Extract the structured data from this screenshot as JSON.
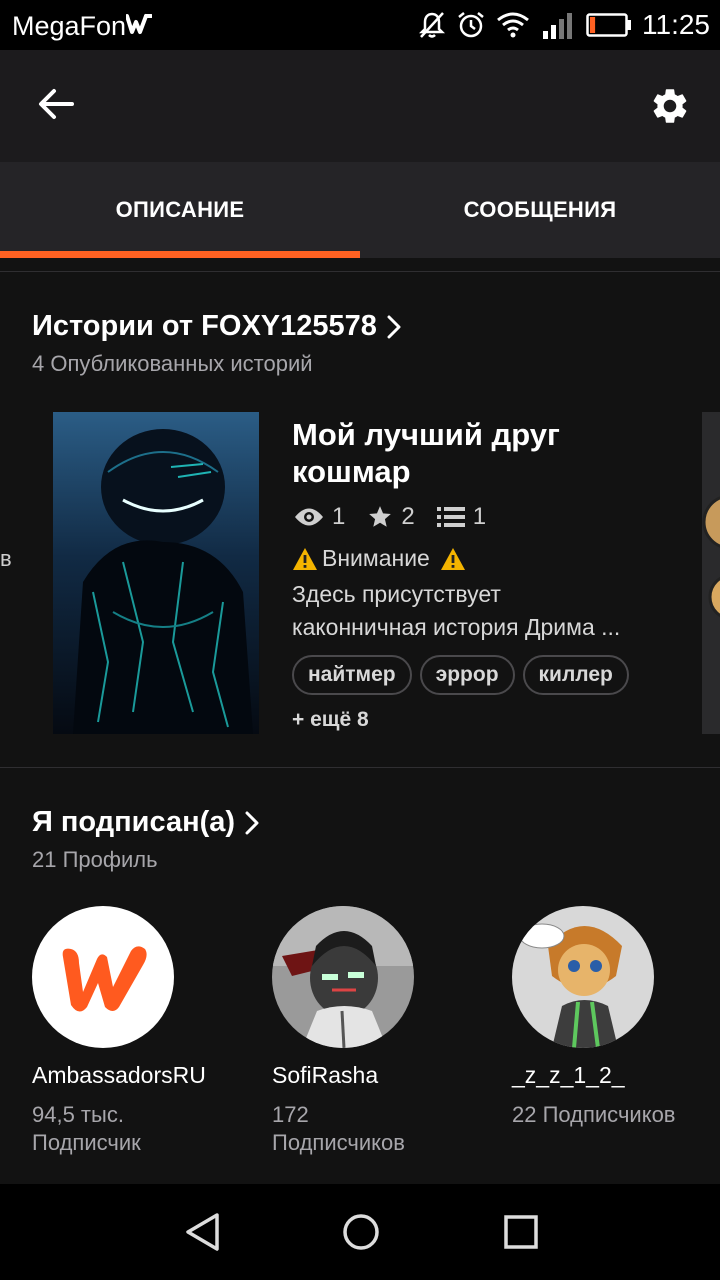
{
  "status_bar": {
    "carrier": "MegaFon",
    "time": "11:25",
    "icons": [
      "wattpad-notification-icon",
      "mute-icon",
      "alarm-icon",
      "wifi-icon",
      "signal-icon",
      "battery-low-icon"
    ],
    "battery_level": 0.15
  },
  "app_bar": {
    "icons": [
      "back-arrow-icon",
      "gear-icon"
    ]
  },
  "tabs": [
    {
      "label": "ОПИСАНИЕ",
      "active": true
    },
    {
      "label": "СООБЩЕНИЯ",
      "active": false
    }
  ],
  "stories_section": {
    "title": "Истории от FOXY125578",
    "subtitle": "4 Опубликованных историй",
    "peek_left_text": "в",
    "story": {
      "title_line1": "Мой лучший друг",
      "title_line2": "кошмар",
      "views": "1",
      "votes": "2",
      "parts": "1",
      "warning": "Внимание",
      "description_line1": "Здесь присутствует",
      "description_line2": "каконничная история Дрима ...",
      "tags": [
        "найтмер",
        "эррор",
        "киллер"
      ],
      "more_tags": "+ ещё 8"
    }
  },
  "following_section": {
    "title": "Я подписан(а)",
    "subtitle": "21 Профиль",
    "profiles": [
      {
        "name": "AmbassadorsRU",
        "count_line1": "94,5 тыс.",
        "count_line2": "Подписчик"
      },
      {
        "name": "SofiRasha",
        "count_line1": "172",
        "count_line2": "Подписчиков"
      },
      {
        "name": "_z_z_1_2_",
        "count_line1": "22 Подписчиков",
        "count_line2": ""
      }
    ]
  },
  "nav_bar": {
    "icons": [
      "back-triangle-icon",
      "home-circle-icon",
      "recents-square-icon"
    ]
  },
  "colors": {
    "accent": "#ff6122",
    "background": "#121212",
    "app_bar": "#1c1b1d",
    "tab_bar": "#252427"
  }
}
